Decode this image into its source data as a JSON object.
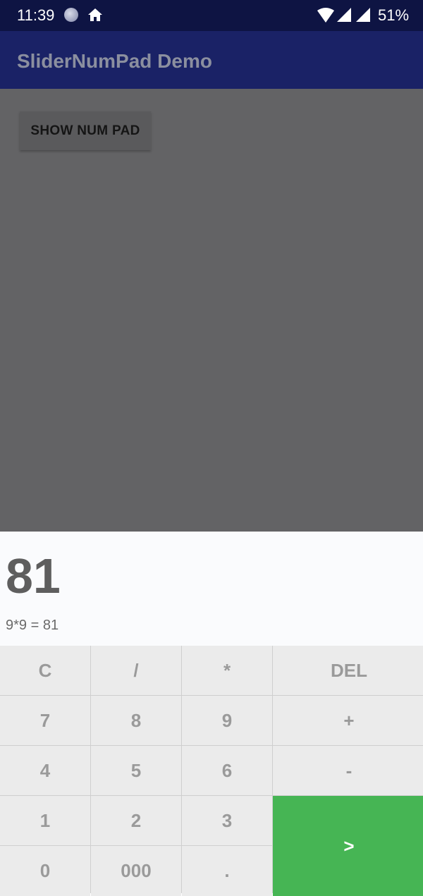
{
  "status_bar": {
    "time": "11:39",
    "battery": "51%"
  },
  "app_bar": {
    "title": "SliderNumPad Demo"
  },
  "main": {
    "show_button_label": "SHOW NUM PAD"
  },
  "numpad": {
    "display_value": "81",
    "expression": "9*9 = 81",
    "keys": {
      "clear": "C",
      "divide": "/",
      "multiply": "*",
      "delete": "DEL",
      "seven": "7",
      "eight": "8",
      "nine": "9",
      "plus": "+",
      "four": "4",
      "five": "5",
      "six": "6",
      "minus": "-",
      "one": "1",
      "two": "2",
      "three": "3",
      "enter": ">",
      "zero": "0",
      "triple_zero": "000",
      "decimal": "."
    },
    "accent_color": "#46b554"
  },
  "colors": {
    "status_bar": "#0e1443",
    "app_bar": "#1a2266",
    "overlay": "#636365"
  }
}
